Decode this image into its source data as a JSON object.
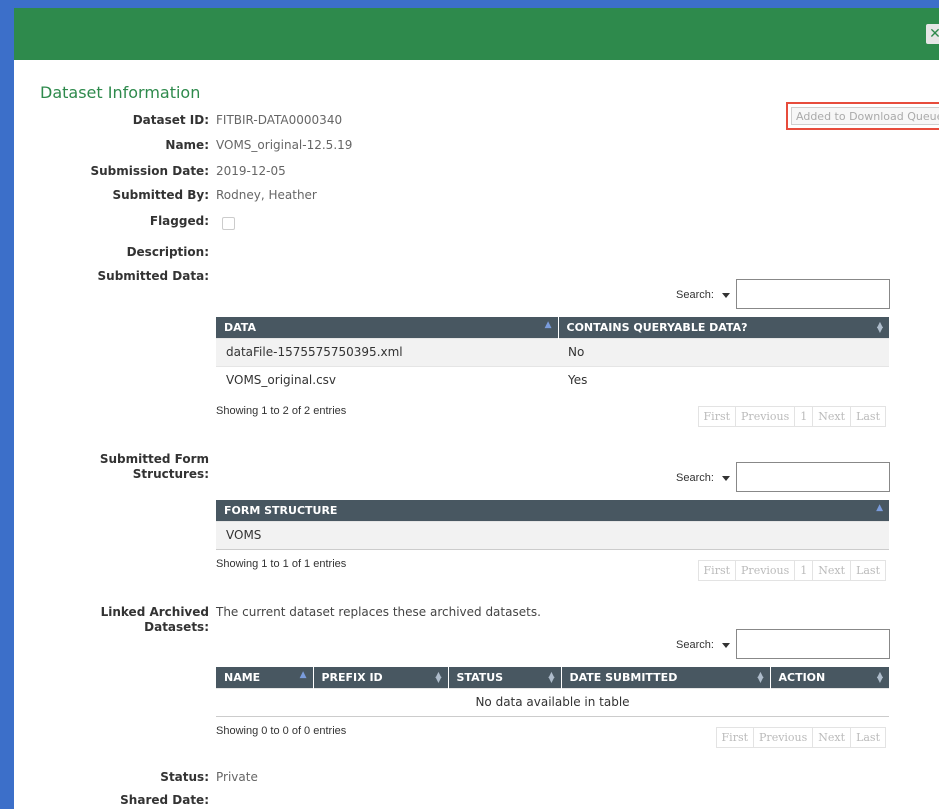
{
  "dialog": {
    "close_glyph": "✕"
  },
  "title": "Dataset Information",
  "download_button": "Added to Download Queue",
  "fields": {
    "dataset_id": {
      "label": "Dataset ID:",
      "value": "FITBIR-DATA0000340"
    },
    "name": {
      "label": "Name:",
      "value": "VOMS_original-12.5.19"
    },
    "submission_date": {
      "label": "Submission Date:",
      "value": "2019-12-05"
    },
    "submitted_by": {
      "label": "Submitted By:",
      "value": "Rodney, Heather"
    },
    "flagged": {
      "label": "Flagged:"
    },
    "description": {
      "label": "Description:",
      "value": ""
    },
    "submitted_data": {
      "label": "Submitted Data:"
    },
    "submitted_forms": {
      "label_line1": "Submitted Form",
      "label_line2": "Structures:"
    },
    "linked_archived": {
      "label_line1": "Linked Archived",
      "label_line2": "Datasets:",
      "text": "The current dataset replaces these archived datasets."
    },
    "status": {
      "label": "Status:",
      "value": "Private"
    },
    "shared_date": {
      "label": "Shared Date:",
      "value": ""
    }
  },
  "search_label": "Search:",
  "data_table": {
    "headers": [
      "DATA",
      "CONTAINS QUERYABLE DATA?"
    ],
    "rows": [
      [
        "dataFile-1575575750395.xml",
        "No"
      ],
      [
        "VOMS_original.csv",
        "Yes"
      ]
    ],
    "info": "Showing 1 to 2 of 2 entries",
    "pager": [
      "First",
      "Previous",
      "1",
      "Next",
      "Last"
    ]
  },
  "form_table": {
    "headers": [
      "FORM STRUCTURE"
    ],
    "rows": [
      [
        "VOMS"
      ]
    ],
    "info": "Showing 1 to 1 of 1 entries",
    "pager": [
      "First",
      "Previous",
      "1",
      "Next",
      "Last"
    ]
  },
  "linked_table": {
    "headers": [
      "NAME",
      "PREFIX ID",
      "STATUS",
      "DATE SUBMITTED",
      "ACTION"
    ],
    "empty": "No data available in table",
    "info": "Showing 0 to 0 of 0 entries",
    "pager": [
      "First",
      "Previous",
      "Next",
      "Last"
    ]
  },
  "colors": {
    "header_green": "#2e8a4c",
    "frame_blue": "#3c6fc9",
    "table_header": "#485761",
    "highlight_red": "#e74c3c"
  }
}
